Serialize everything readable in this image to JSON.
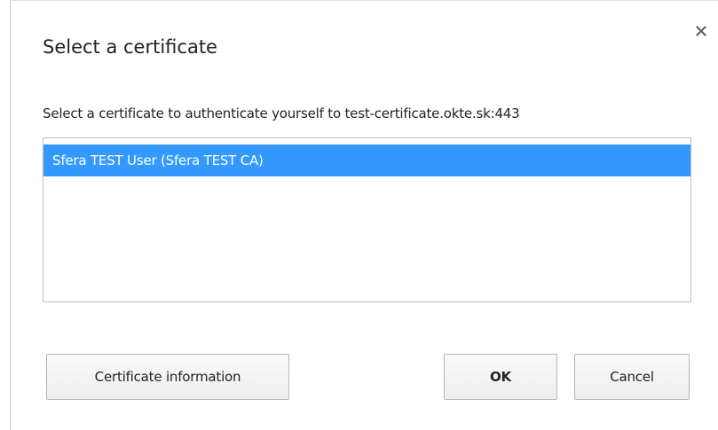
{
  "dialog": {
    "title": "Select a certificate",
    "prompt": "Select a certificate to authenticate yourself to test-certificate.okte.sk:443",
    "close_icon": "close-icon"
  },
  "certificates": {
    "items": [
      {
        "label": "Sfera TEST User (Sfera TEST CA)",
        "selected": true
      }
    ],
    "selection_color": "#3399ff"
  },
  "buttons": {
    "certificate_information": "Certificate information",
    "ok": "OK",
    "cancel": "Cancel"
  }
}
